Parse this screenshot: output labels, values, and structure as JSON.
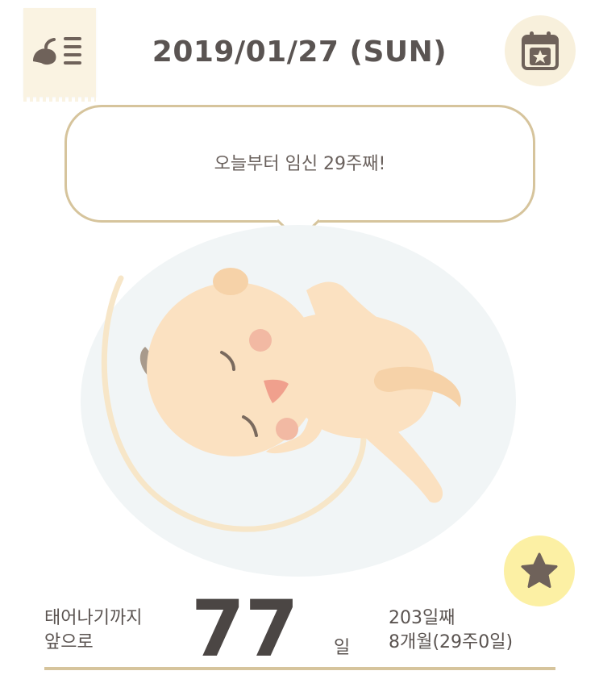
{
  "header": {
    "date_title": "2019/01/27 (SUN)",
    "menu_icon": "menu-list-icon",
    "calendar_icon": "calendar-star-icon"
  },
  "speech": {
    "message": "오늘부터 임신 29주째!"
  },
  "illustration": {
    "subject": "fetus-icon"
  },
  "favorite": {
    "icon": "star-icon"
  },
  "countdown": {
    "label_line1": "태어나기까지",
    "label_line2": "앞으로",
    "days_remaining": "77",
    "unit": "일",
    "day_count": "203일째",
    "month_week": "8개월(29주0일)"
  },
  "colors": {
    "accent_tan": "#d6c49c",
    "badge_cream": "#f8f0dc",
    "star_yellow": "#fcf0a4",
    "icon_brown": "#6f625a"
  }
}
